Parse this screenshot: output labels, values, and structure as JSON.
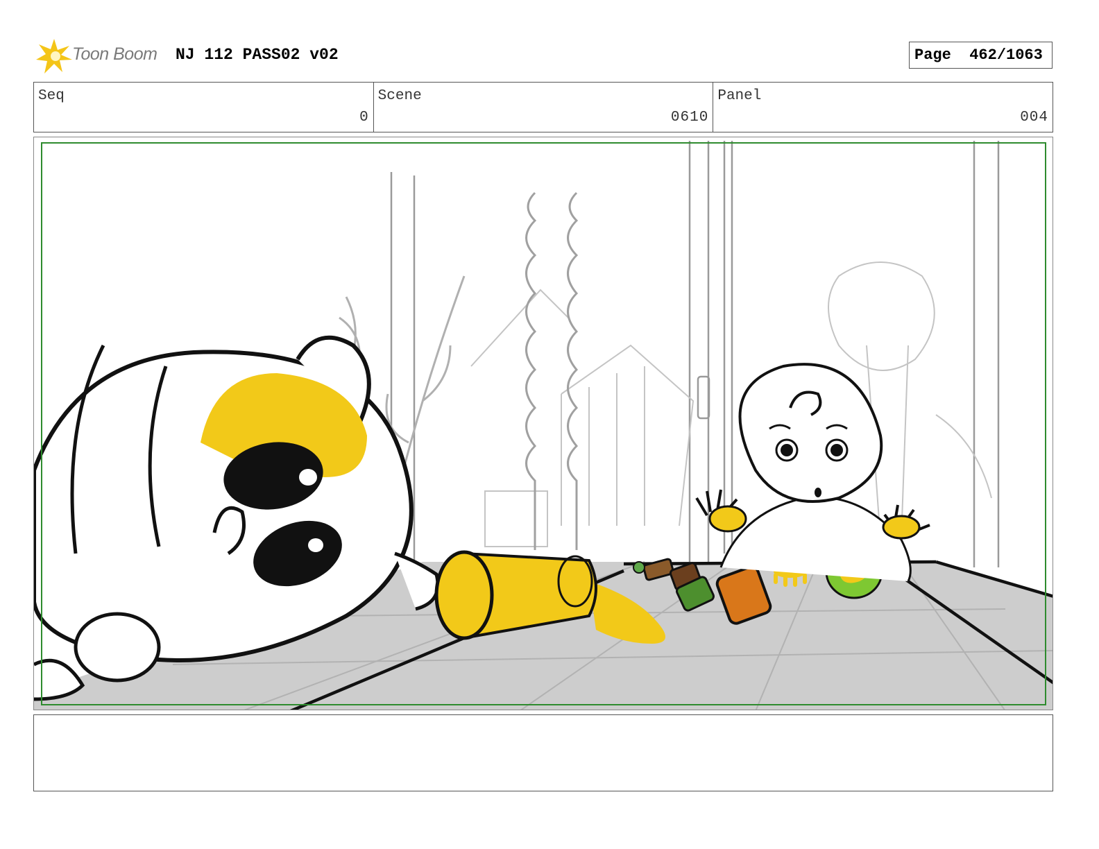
{
  "header": {
    "logo_text": "Toon Boom",
    "title": "NJ 112 PASS02 v02",
    "page_label": "Page",
    "page_value": "462/1063"
  },
  "info": {
    "seq_label": "Seq",
    "seq_value": "0",
    "scene_label": "Scene",
    "scene_value": "0610",
    "panel_label": "Panel",
    "panel_value": "004"
  },
  "colors": {
    "safe_frame": "#2e8b2e",
    "highlight_yellow": "#f2c919",
    "table_gray": "#cdcdcd"
  },
  "icons": {
    "logo": "toon-boom-star-icon"
  }
}
